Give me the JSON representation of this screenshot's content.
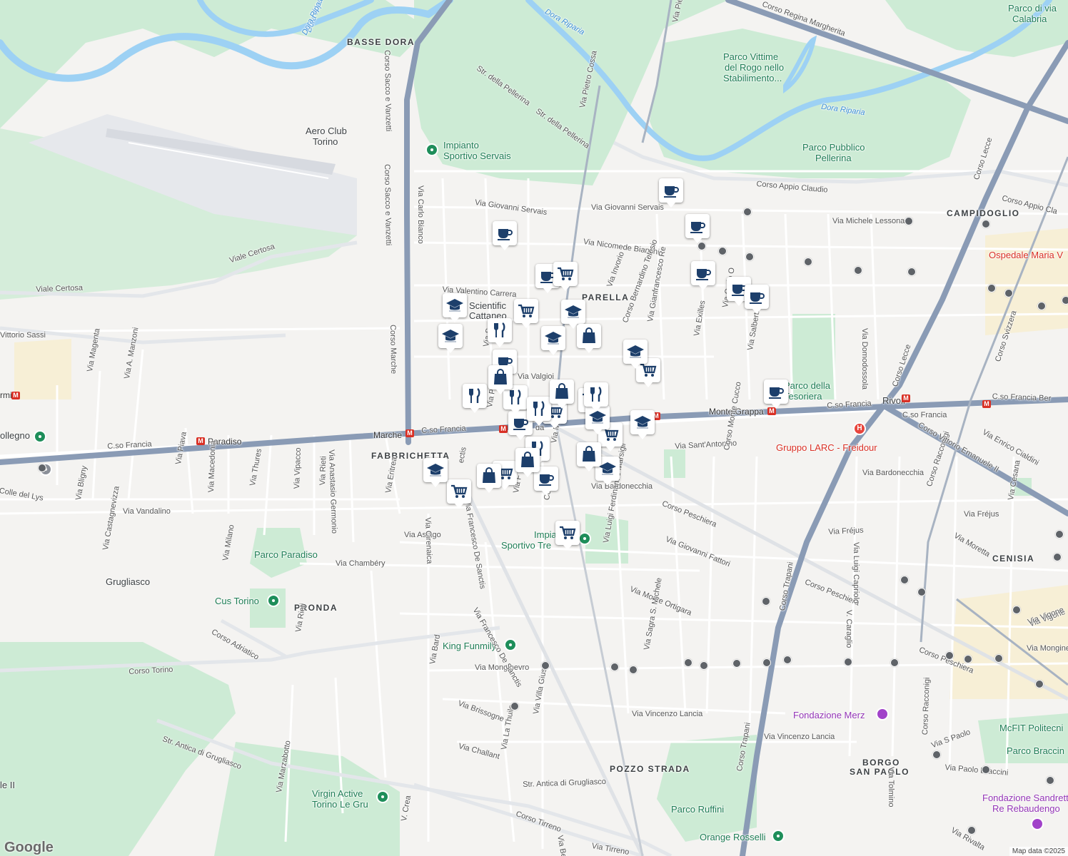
{
  "map": {
    "attribution": "Map data ©2025",
    "logo": "Google",
    "colors": {
      "land": "#f4f3f1",
      "park": "#cdebd5",
      "water": "#9dd1f4",
      "arterial": "#8a9bb5",
      "marker_icon": "#1d3f6b",
      "poi_green": "#1e8e5a"
    },
    "districts": [
      "BASSE DORA",
      "PARELLA",
      "CAMPIDOGLIO",
      "FABBRICHETTA",
      "CENISIA",
      "PRONDA",
      "POZZO STRADA",
      "BORGO",
      "SAN PAOLO"
    ],
    "parks": [
      "Parco Vittime",
      "del Rogo nello",
      "Stabilimento...",
      "Parco Pubblico",
      "Pellerina",
      "Parco della",
      "Tesoriera",
      "Parco Paradiso",
      "Parco Ruffini",
      "Parco di via",
      "Calabria",
      "Cus Torino",
      "Virgin Active",
      "Torino Le Gru",
      "Orange Rosselli",
      "King Funmily",
      "Impianto",
      "Sportivo Servais",
      "Impia",
      "Sportivo Tre",
      "McFIT Politecni",
      "Parco Braccin"
    ],
    "places": [
      "Aero Club",
      "Torino",
      "Scientific",
      "Cattaneo",
      "Gruppo LARC - Freidour",
      "Ospedale Maria V",
      "Fondazione Merz",
      "Fondazione Sandretto",
      "Re Rebaudengo",
      "Grugliasco",
      "Rivoli",
      "Paradiso",
      "Marche",
      "Monte Grappa",
      "Vittorio Sassi",
      "rmi",
      "ollegno",
      "le II",
      "da"
    ],
    "rivers": [
      "Dora Riparia",
      "Dora Ripa",
      "Dora Riparia",
      "Dora Riparia"
    ],
    "roads": [
      "Corso Sacco e Vanzetti",
      "Corso Sacco e Vanzetti",
      "Corso Marche",
      "Viale Certosa",
      "Viale Certosa",
      "C.so Francia",
      "C.so Francia",
      "C.so Francia",
      "C.so Francia",
      "C.so Francia Ber",
      "Corso Regina Margherita",
      "Corso Appio Claudio",
      "Corso Appio Cla",
      "Via Pietro Cossa",
      "Via Pietro Co",
      "Str. della Pellerina",
      "Str. della Pellerina",
      "Via Giovanni Servais",
      "Via Giovanni Servais",
      "Via Nicomede Bianchi",
      "Via Michele Lessona",
      "Via Valentino Carrera",
      "Via Carlo Bianco",
      "Corso Lecce",
      "Corso Svizzera",
      "Corso Lecce",
      "Corso Trapani",
      "Corso Trapani",
      "Corso Racconigi",
      "Corso Racconigi",
      "Corso Peschiera",
      "Corso Peschiera",
      "Corso Peschiera",
      "Corso Vittorio Emanuele II",
      "Via Bardonecchia",
      "Via Bardonecchia",
      "Via Sant'Antonino",
      "Via Giovanni Fattori",
      "Via Fréjus",
      "Via Fréjus",
      "Via Monte Ortigara",
      "Via Monginevro",
      "Via Mongine",
      "Via Vincenzo Lancia",
      "Via Vincenzo Lancia",
      "Via Francesco De Sanctis",
      "Via Francesco De Sanctis",
      "Via Luigi Ferdinando Marsigli",
      "Via Sagra S. Michele",
      "Corso Torino",
      "Corso Adriatico",
      "Str. Antica di Grugliasco",
      "Str. Antica di Grugliasco",
      "Corso Tirreno",
      "Via Tirreno",
      "Via Rivalta",
      "Via S Paolo",
      "Via Paolo Braccini",
      "Via Tolmino",
      "Via Asiago",
      "Via Chambéry",
      "Via Vandalino",
      "Colle del Lys",
      "Via Castagnevizza",
      "Via Bligny",
      "Via Piava",
      "Via Macedonia",
      "Via Thures",
      "Via Milano",
      "Via Vipacco",
      "Via Rieti",
      "Via Rieti",
      "Via Anastasio Germonio",
      "Via Eritrea",
      "Via Cirenaica",
      "Via Bard",
      "Via Brissogne",
      "Via Challant",
      "Via La Thuile",
      "Via Villa Giusti",
      "Via Marzabotto",
      "V. Crea",
      "Via Magenta",
      "Via A. Manzoni",
      "Via Valgioi",
      "Via Invorio",
      "Corso Bernardino Telesio",
      "Via Gianfrancesco Re",
      "Via Exilles",
      "Via Carlo O",
      "Via Salbertrand",
      "Via Domodossola",
      "Corso Monte Cucco",
      "Via Luigi Capriolo",
      "V. Caraglio",
      "Via Enrico Cialdini",
      "Via Moretta",
      "Via Cesana",
      "Via Vigone",
      "Via Benga",
      "Corso",
      "Via P",
      "Via So",
      "Via F",
      "Via Ma",
      "ectis",
      "Via Vigone"
    ]
  },
  "markers": [
    {
      "type": "cafe",
      "name": "cafe-marker"
    },
    {
      "type": "cafe",
      "name": "cafe-marker"
    },
    {
      "type": "cafe",
      "name": "cafe-marker"
    },
    {
      "type": "cafe",
      "name": "cafe-marker"
    },
    {
      "type": "cafe",
      "name": "cafe-marker"
    },
    {
      "type": "cafe",
      "name": "cafe-marker"
    },
    {
      "type": "cafe",
      "name": "cafe-marker"
    },
    {
      "type": "cafe",
      "name": "cafe-marker"
    },
    {
      "type": "cafe",
      "name": "cafe-marker"
    },
    {
      "type": "cafe",
      "name": "cafe-marker"
    },
    {
      "type": "cafe",
      "name": "cafe-marker"
    },
    {
      "type": "shop",
      "name": "shopping-cart-marker"
    },
    {
      "type": "shop",
      "name": "shopping-cart-marker"
    },
    {
      "type": "shop",
      "name": "shopping-cart-marker"
    },
    {
      "type": "shop",
      "name": "shopping-cart-marker"
    },
    {
      "type": "shop",
      "name": "shopping-cart-marker"
    },
    {
      "type": "shop",
      "name": "shopping-cart-marker"
    },
    {
      "type": "shop",
      "name": "shopping-cart-marker"
    },
    {
      "type": "shop",
      "name": "shopping-cart-marker"
    },
    {
      "type": "shop",
      "name": "shopping-cart-marker"
    },
    {
      "type": "school",
      "name": "school-marker"
    },
    {
      "type": "school",
      "name": "school-marker"
    },
    {
      "type": "school",
      "name": "school-marker"
    },
    {
      "type": "school",
      "name": "school-marker"
    },
    {
      "type": "school",
      "name": "school-marker"
    },
    {
      "type": "school",
      "name": "school-marker"
    },
    {
      "type": "school",
      "name": "school-marker"
    },
    {
      "type": "school",
      "name": "school-marker"
    },
    {
      "type": "school",
      "name": "school-marker"
    },
    {
      "type": "restaurant",
      "name": "restaurant-marker"
    },
    {
      "type": "restaurant",
      "name": "restaurant-marker"
    },
    {
      "type": "restaurant",
      "name": "restaurant-marker"
    },
    {
      "type": "restaurant",
      "name": "restaurant-marker"
    },
    {
      "type": "restaurant",
      "name": "restaurant-marker"
    },
    {
      "type": "restaurant",
      "name": "restaurant-marker"
    },
    {
      "type": "bag",
      "name": "shopping-bag-marker"
    },
    {
      "type": "bag",
      "name": "shopping-bag-marker"
    },
    {
      "type": "bag",
      "name": "shopping-bag-marker"
    },
    {
      "type": "bag",
      "name": "shopping-bag-marker"
    },
    {
      "type": "bag",
      "name": "shopping-bag-marker"
    },
    {
      "type": "bag",
      "name": "shopping-bag-marker"
    }
  ],
  "metro_glyph": "M",
  "hospital_glyph": "H"
}
